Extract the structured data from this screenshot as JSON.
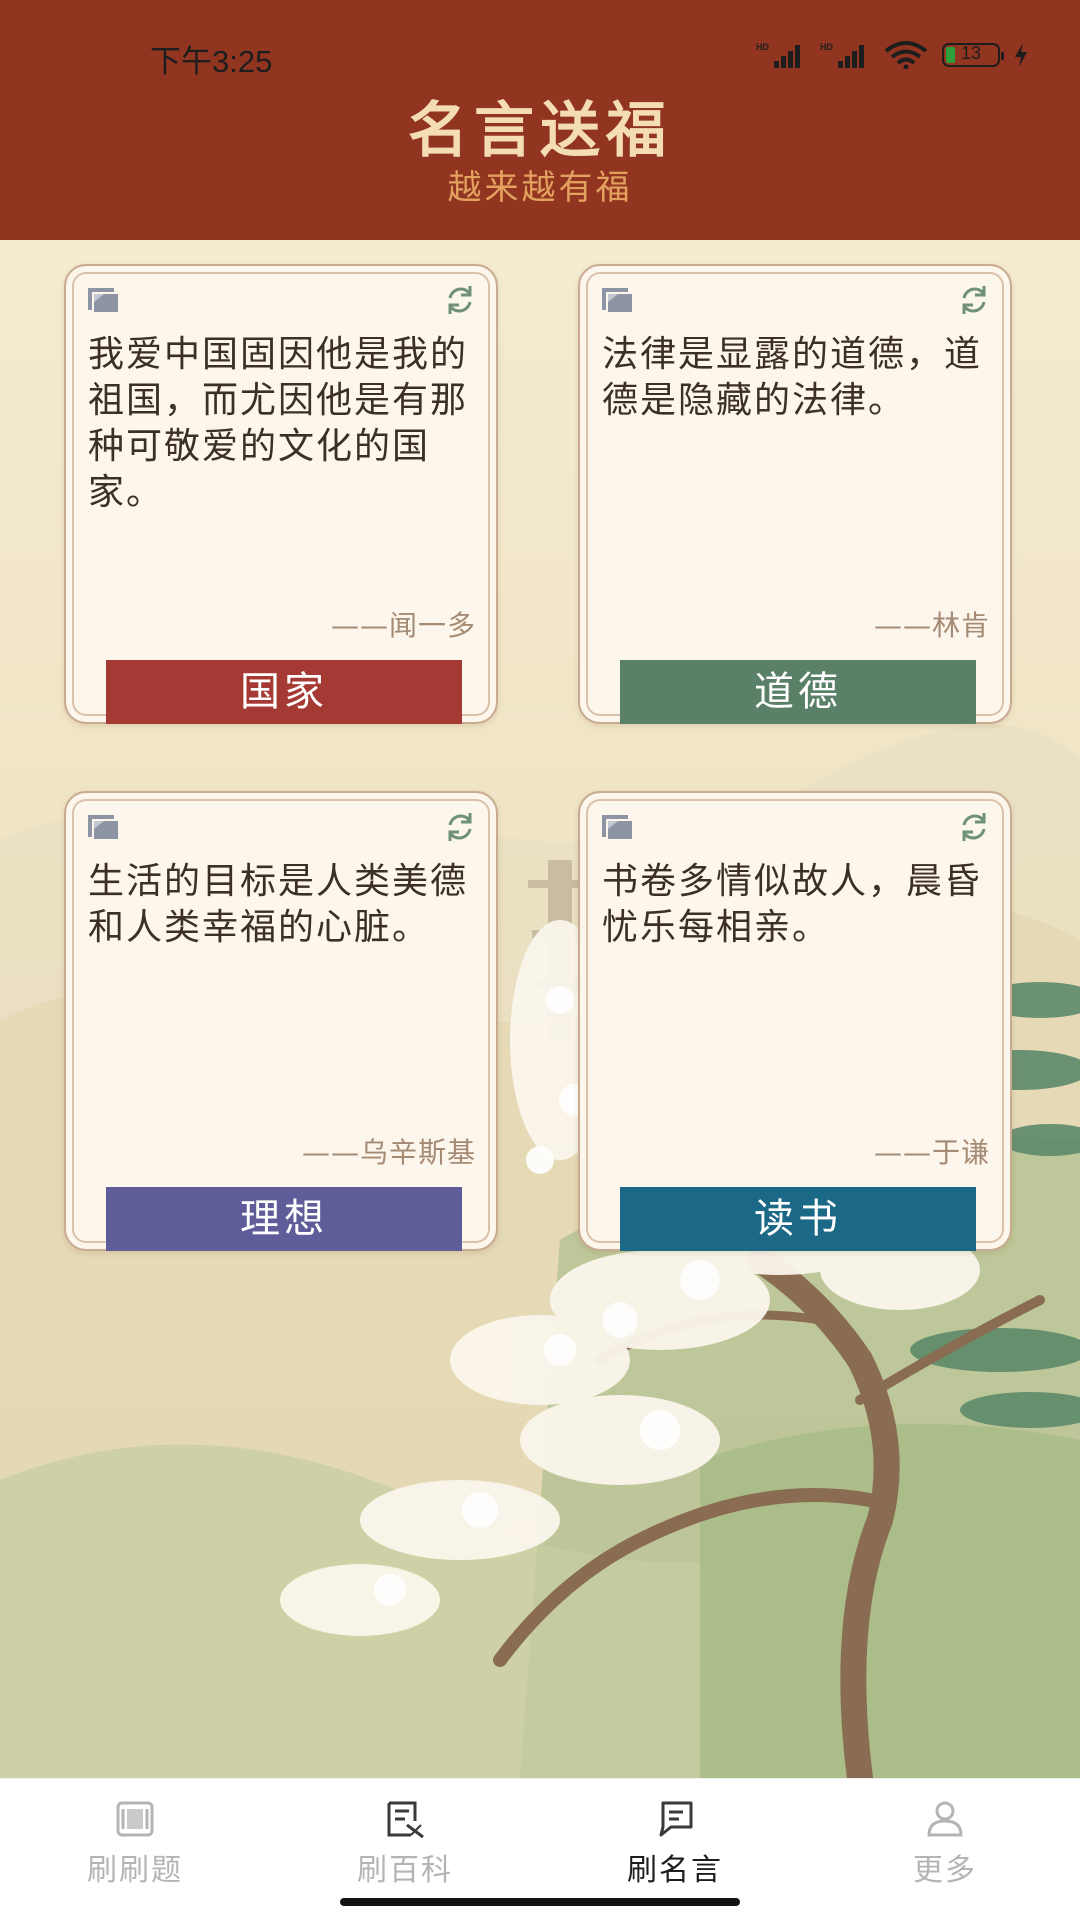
{
  "status_bar": {
    "time": "下午3:25",
    "battery": "13"
  },
  "header": {
    "title": "名言送福",
    "subtitle": "越来越有福"
  },
  "colors": {
    "header_bg": "#923520",
    "tag_country": "#a53a34",
    "tag_morality": "#5a8068",
    "tag_ideal": "#5e5c99",
    "tag_reading": "#1b6887"
  },
  "cards": [
    {
      "quote": "我爱中国固因他是我的祖国，而尤因他是有那种可敬爱的文化的国家。",
      "author": "——闻一多",
      "tag": "国家",
      "tag_color": "#a53a34"
    },
    {
      "quote": "法律是显露的道德，道德是隐藏的法律。",
      "author": "——林肯",
      "tag": "道德",
      "tag_color": "#5a8068"
    },
    {
      "quote": "生活的目标是人类美德和人类幸福的心脏。",
      "author": "——乌辛斯基",
      "tag": "理想",
      "tag_color": "#5e5c99"
    },
    {
      "quote": "书卷多情似故人，晨昏忧乐每相亲。",
      "author": "——于谦",
      "tag": "读书",
      "tag_color": "#1b6887"
    }
  ],
  "icons": {
    "card_copy": "copy-icon",
    "card_refresh": "refresh-icon",
    "nav": [
      "questions-icon",
      "encyclopedia-icon",
      "quotes-icon",
      "profile-icon"
    ]
  },
  "nav": {
    "items": [
      {
        "label": "刷刷题",
        "active": false
      },
      {
        "label": "刷百科",
        "active": false
      },
      {
        "label": "刷名言",
        "active": true
      },
      {
        "label": "更多",
        "active": false
      }
    ]
  }
}
